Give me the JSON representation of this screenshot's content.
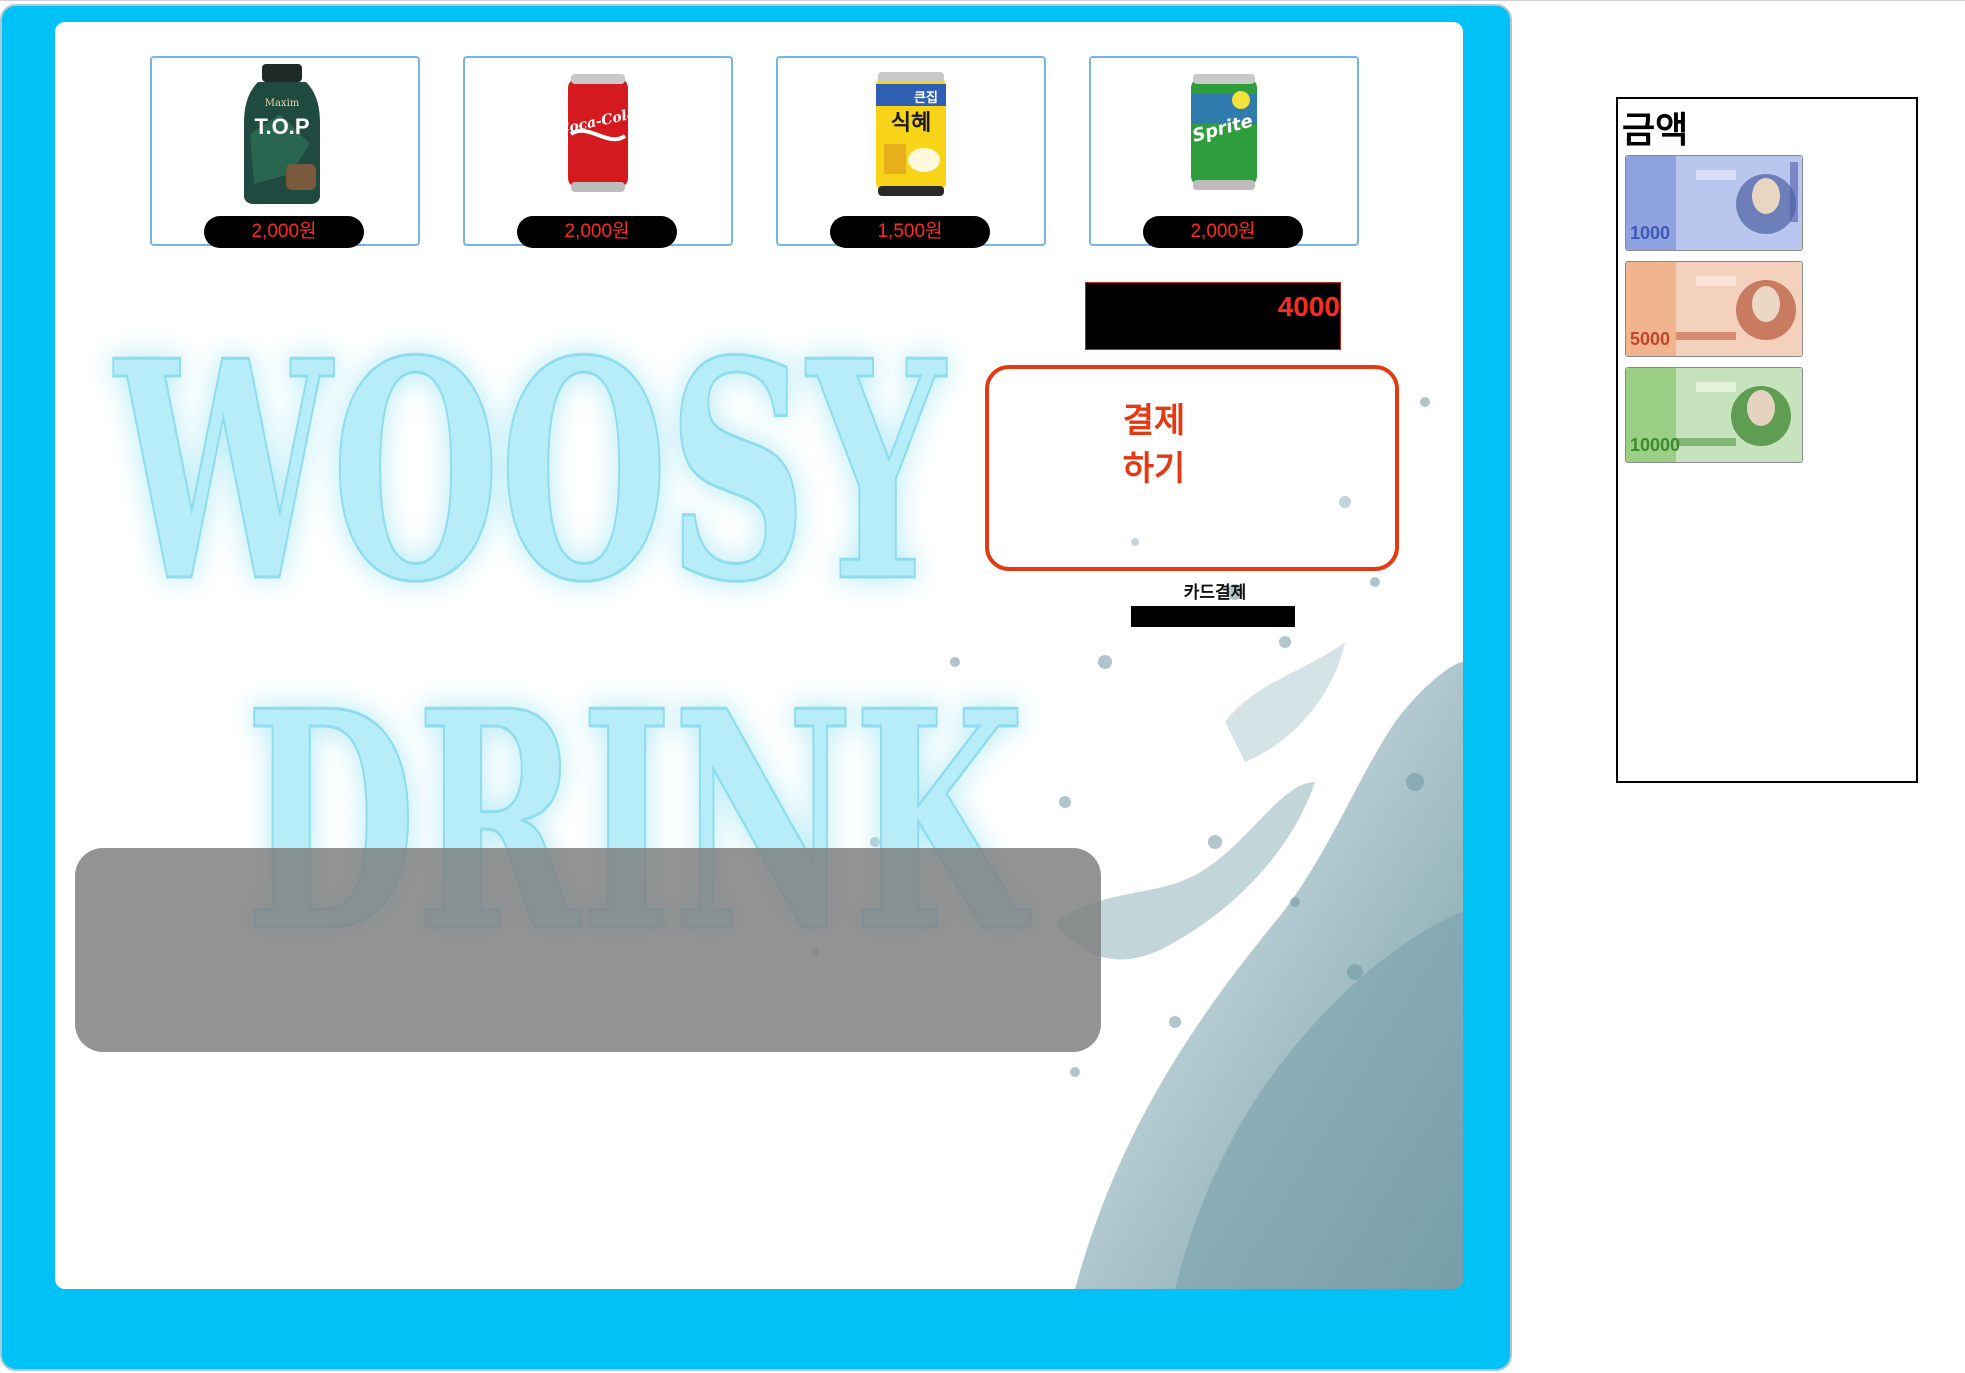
{
  "products": [
    {
      "name": "T.O.P",
      "price": "2,000원",
      "icon": "coffee-bottle-icon"
    },
    {
      "name": "Coca-Cola",
      "price": "2,000원",
      "icon": "cola-can-icon"
    },
    {
      "name": "큰집 식혜",
      "price": "1,500원",
      "icon": "sikhye-can-icon"
    },
    {
      "name": "Sprite",
      "price": "2,000원",
      "icon": "sprite-can-icon"
    }
  ],
  "product_labels": {
    "top_brand": "Maxim",
    "top_text": "T.O.P",
    "cola_text": "Coca-Cola",
    "sikhye_small": "큰집",
    "sikhye_big": "식혜",
    "sprite_text": "Sprite"
  },
  "logo": {
    "line1": "WOOSY",
    "line2": "DRINK"
  },
  "display": {
    "amount": "4000"
  },
  "pay_button": {
    "line1": "결제",
    "line2": "하기"
  },
  "card": {
    "label": "카드결제"
  },
  "money": {
    "title": "금액",
    "bills": [
      {
        "value": "1000",
        "color": "#3f57b8"
      },
      {
        "value": "5000",
        "color": "#c2452d"
      },
      {
        "value": "10000",
        "color": "#3c8a2c"
      }
    ]
  }
}
